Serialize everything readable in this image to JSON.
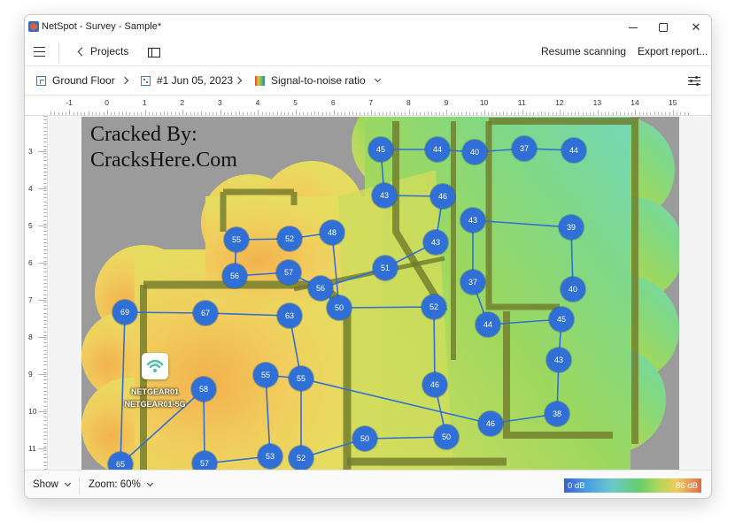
{
  "window": {
    "title": "NetSpot - Survey - Sample*",
    "controls": {
      "minimize": "minimize",
      "maximize": "maximize",
      "close": "close"
    }
  },
  "toolbar": {
    "projects_label": "Projects",
    "resume_label": "Resume scanning",
    "export_label": "Export report..."
  },
  "breadcrumb": {
    "floor": "Ground Floor",
    "survey": "#1 Jun 05, 2023",
    "metric": "Signal-to-noise ratio"
  },
  "ruler": {
    "x_ticks": [
      "-1",
      "0",
      "1",
      "2",
      "3",
      "4",
      "5",
      "6",
      "7",
      "8",
      "9",
      "10",
      "11",
      "12",
      "13",
      "14",
      "15"
    ],
    "y_ticks": [
      "3",
      "4",
      "5",
      "6",
      "7",
      "8",
      "9",
      "10",
      "11"
    ]
  },
  "map": {
    "watermark_line1": "Cracked By:",
    "watermark_line2": "CracksHere.Com",
    "router": {
      "ssid_1": "NETGEAR01",
      "ssid_2": "NETGEAR01-5G"
    },
    "points": [
      {
        "v": "45"
      },
      {
        "v": "44"
      },
      {
        "v": "40"
      },
      {
        "v": "37"
      },
      {
        "v": "44"
      },
      {
        "v": "43"
      },
      {
        "v": "46"
      },
      {
        "v": "43"
      },
      {
        "v": "39"
      },
      {
        "v": "55"
      },
      {
        "v": "52"
      },
      {
        "v": "48"
      },
      {
        "v": "43"
      },
      {
        "v": "56"
      },
      {
        "v": "57"
      },
      {
        "v": "56"
      },
      {
        "v": "51"
      },
      {
        "v": "37"
      },
      {
        "v": "40"
      },
      {
        "v": "69"
      },
      {
        "v": "67"
      },
      {
        "v": "63"
      },
      {
        "v": "50"
      },
      {
        "v": "52"
      },
      {
        "v": "44"
      },
      {
        "v": "45"
      },
      {
        "v": "43"
      },
      {
        "v": "55"
      },
      {
        "v": "55"
      },
      {
        "v": "58"
      },
      {
        "v": "46"
      },
      {
        "v": "38"
      },
      {
        "v": "46"
      },
      {
        "v": "50"
      },
      {
        "v": "50"
      },
      {
        "v": "65"
      },
      {
        "v": "57"
      },
      {
        "v": "53"
      },
      {
        "v": "52"
      }
    ]
  },
  "statusbar": {
    "show_label": "Show",
    "zoom_label": "Zoom: 60%",
    "legend_min": "0 dB",
    "legend_max": "86 dB"
  },
  "colors": {
    "accent": "#2f6fd6",
    "point_fill": "#2f6fd6",
    "heat_high": "#f0c95a",
    "heat_mid": "#b9d65a",
    "heat_low": "#66cf9a",
    "wall": "#6f6a1f",
    "outside": "#9b9b9b"
  }
}
